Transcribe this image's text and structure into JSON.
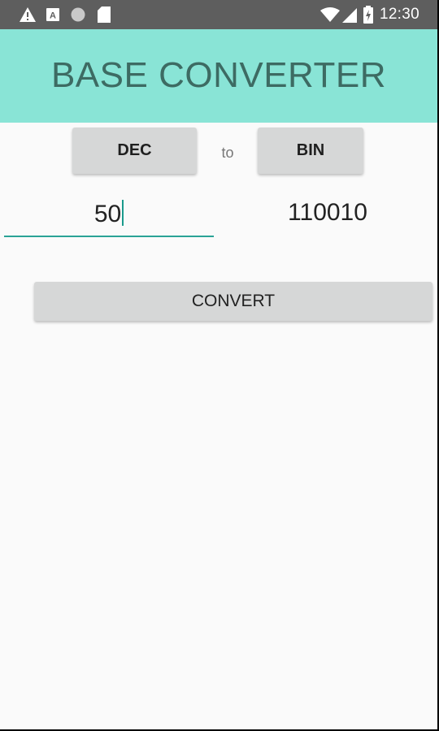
{
  "status_bar": {
    "time": "12:30",
    "icons": [
      "alert-icon",
      "text-a-icon",
      "circle-icon",
      "sd-card-icon",
      "wifi-icon",
      "signal-icon",
      "battery-icon"
    ]
  },
  "app_bar": {
    "title": "BASE CONVERTER",
    "color": "#89e4d6"
  },
  "converter": {
    "from_base": "DEC",
    "to_label": "to",
    "to_base": "BIN",
    "input_value": "50",
    "result_value": "110010",
    "convert_label": "CONVERT",
    "accent_color": "#2aa396"
  }
}
